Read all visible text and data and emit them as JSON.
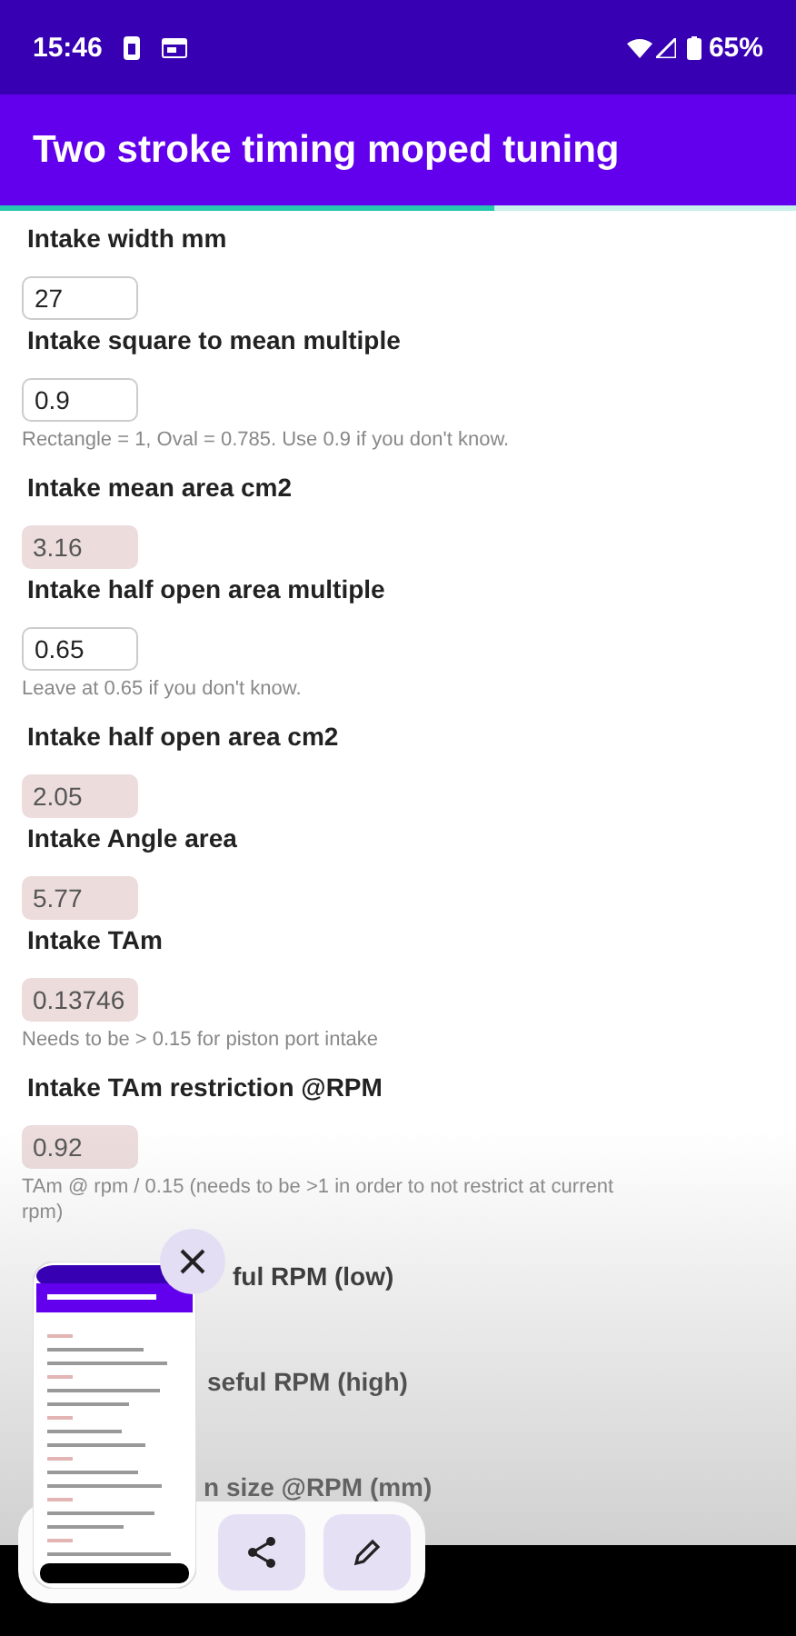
{
  "status_bar": {
    "time": "15:46",
    "battery": "65%"
  },
  "app_bar": {
    "title": "Two stroke timing moped tuning",
    "progress": {
      "level": 0.62
    }
  },
  "fields": [
    {
      "label": "Intake width mm",
      "kind": "label_only"
    },
    {
      "kind": "input",
      "value": "27"
    },
    {
      "label": "Intake square to mean multiple",
      "kind": "input",
      "value": "0.9",
      "hint": "Rectangle = 1, Oval = 0.785. Use 0.9 if you don't know."
    },
    {
      "label": "Intake mean area cm2",
      "kind": "computed",
      "value": "3.16"
    },
    {
      "label": "Intake half open area multiple",
      "kind": "input",
      "value": "0.65",
      "hint": "Leave at 0.65 if you don't know."
    },
    {
      "label": "Intake half open area cm2",
      "kind": "computed",
      "value": "2.05"
    },
    {
      "label": "Intake Angle area",
      "kind": "computed",
      "value": "5.77"
    },
    {
      "label": "Intake TAm",
      "kind": "computed",
      "value": "0.13746",
      "hint": "Needs to be > 0.15 for piston port intake"
    },
    {
      "label": "Intake TAm restriction @RPM",
      "kind": "computed",
      "value": "0.92",
      "hint": "TAm @ rpm / 0.15 (needs to be >1 in order to not restrict at current rpm)"
    }
  ],
  "covered_labels": [
    {
      "end": "ful RPM (low)"
    },
    {
      "end": "seful RPM (high)"
    },
    {
      "end": "n size @RPM (mm)"
    }
  ],
  "screenshot_preview": {
    "actions": [
      {
        "kind": "share"
      },
      {
        "kind": "edit"
      }
    ]
  }
}
